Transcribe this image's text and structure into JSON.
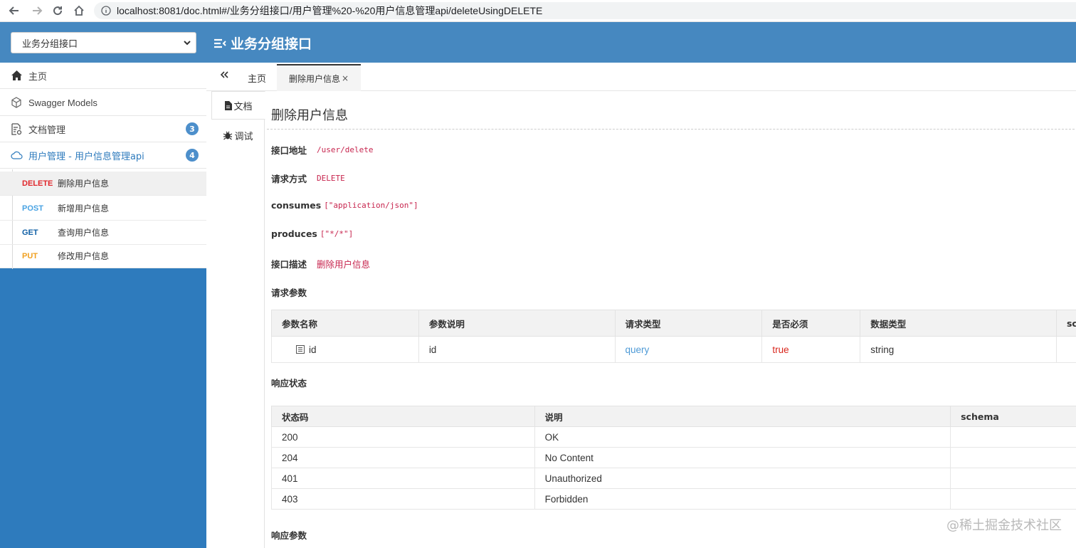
{
  "browser": {
    "url": "localhost:8081/doc.html#/业务分组接口/用户管理%20-%20用户信息管理api/deleteUsingDELETE"
  },
  "header": {
    "group_select": "业务分组接口",
    "title": "业务分组接口"
  },
  "sidebar": {
    "items": [
      {
        "label": "主页",
        "icon": "home-icon"
      },
      {
        "label": "Swagger Models",
        "icon": "cube-icon"
      },
      {
        "label": "文档管理",
        "icon": "doc-settings-icon",
        "badge": "3"
      },
      {
        "label": "用户管理 - 用户信息管理api",
        "icon": "cloud-icon",
        "badge": "4"
      }
    ],
    "endpoints": [
      {
        "method": "DELETE",
        "name": "删除用户信息",
        "color": "#e0282d"
      },
      {
        "method": "POST",
        "name": "新增用户信息",
        "color": "#49a3e3"
      },
      {
        "method": "GET",
        "name": "查询用户信息",
        "color": "#0f5fa5"
      },
      {
        "method": "PUT",
        "name": "修改用户信息",
        "color": "#f0a020"
      }
    ]
  },
  "tabs": {
    "home": "主页",
    "active": "删除用户信息",
    "close": "×"
  },
  "vtabs": {
    "doc": "文档",
    "debug": "调试"
  },
  "doc": {
    "title": "删除用户信息",
    "url_label": "接口地址",
    "url_value": "/user/delete",
    "method_label": "请求方式",
    "method_value": "DELETE",
    "consumes_label": "consumes",
    "consumes_value": "[\"application/json\"]",
    "produces_label": "produces",
    "produces_value": "[\"*/*\"]",
    "desc_label": "接口描述",
    "desc_value": "删除用户信息",
    "req_params_label": "请求参数",
    "params_headers": [
      "参数名称",
      "参数说明",
      "请求类型",
      "是否必须",
      "数据类型",
      "sc"
    ],
    "params_rows": [
      {
        "name": "id",
        "desc": "id",
        "in": "query",
        "required": "true",
        "type": "string",
        "schema": ""
      }
    ],
    "resp_status_label": "响应状态",
    "resp_headers": [
      "状态码",
      "说明",
      "schema"
    ],
    "resp_rows": [
      {
        "code": "200",
        "desc": "OK",
        "schema": ""
      },
      {
        "code": "204",
        "desc": "No Content",
        "schema": ""
      },
      {
        "code": "401",
        "desc": "Unauthorized",
        "schema": ""
      },
      {
        "code": "403",
        "desc": "Forbidden",
        "schema": ""
      }
    ],
    "resp_params_label": "响应参数"
  },
  "watermark": "@稀土掘金技术社区"
}
